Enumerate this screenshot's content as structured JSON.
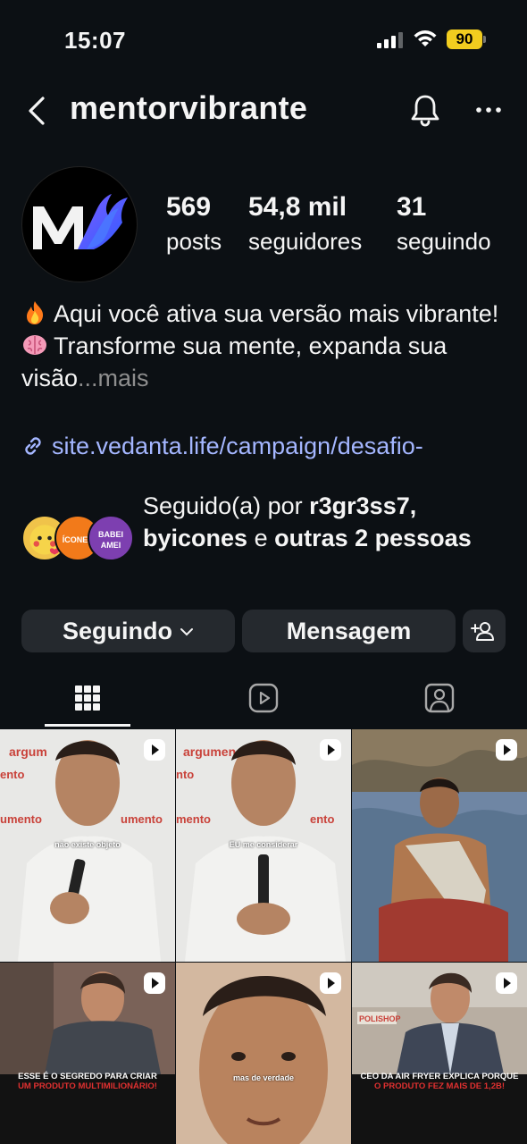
{
  "status_bar": {
    "time": "15:07",
    "battery": "90",
    "battery_color": "#f2cd1f"
  },
  "header": {
    "username": "mentorvibrante",
    "icons": [
      "back-icon",
      "bell-icon",
      "more-icon"
    ]
  },
  "profile": {
    "avatar_logo": "MV",
    "stats": [
      {
        "value": "569",
        "label": "posts"
      },
      {
        "value": "54,8 mil",
        "label": "seguidores"
      },
      {
        "value": "31",
        "label": "seguindo"
      }
    ],
    "bio_line1": "Aqui você ativa sua versão mais vibrante!",
    "bio_line2": "Transforme sua mente, expanda sua visão",
    "bio_ellipsis": "...",
    "bio_more": "mais",
    "link": "site.vedanta.life/campaign/desafio-",
    "link_color": "#a4b6ff"
  },
  "followed_by": {
    "prefix": "Seguido(a) por",
    "user1": "r3gr3ss7,",
    "user2": "byicones",
    "connector": "e",
    "others": "outras 2 pessoas",
    "avatar_labels": [
      "ÍCONES",
      "BABEI AMEI"
    ]
  },
  "buttons": {
    "following": "Seguindo",
    "message": "Mensagem"
  },
  "tabs": [
    "grid-tab",
    "reels-tab",
    "tagged-tab"
  ],
  "posts": [
    {
      "caption": "não existe objeto",
      "sign": "argumento"
    },
    {
      "caption": "EU me considerar",
      "sign": "argumento"
    },
    {
      "caption": ""
    },
    {
      "caption_line1": "ESSE É O SEGREDO PARA CRIAR",
      "caption_line2": "UM PRODUTO MULTIMILIONÁRIO!"
    },
    {
      "caption": "mas de verdade"
    },
    {
      "caption_line1": "CEO DA AIR FRYER EXPLICA PORQUE",
      "caption_line2": "O PRODUTO FEZ MAIS DE 1,2B!",
      "sign": "POLISHOP"
    }
  ]
}
